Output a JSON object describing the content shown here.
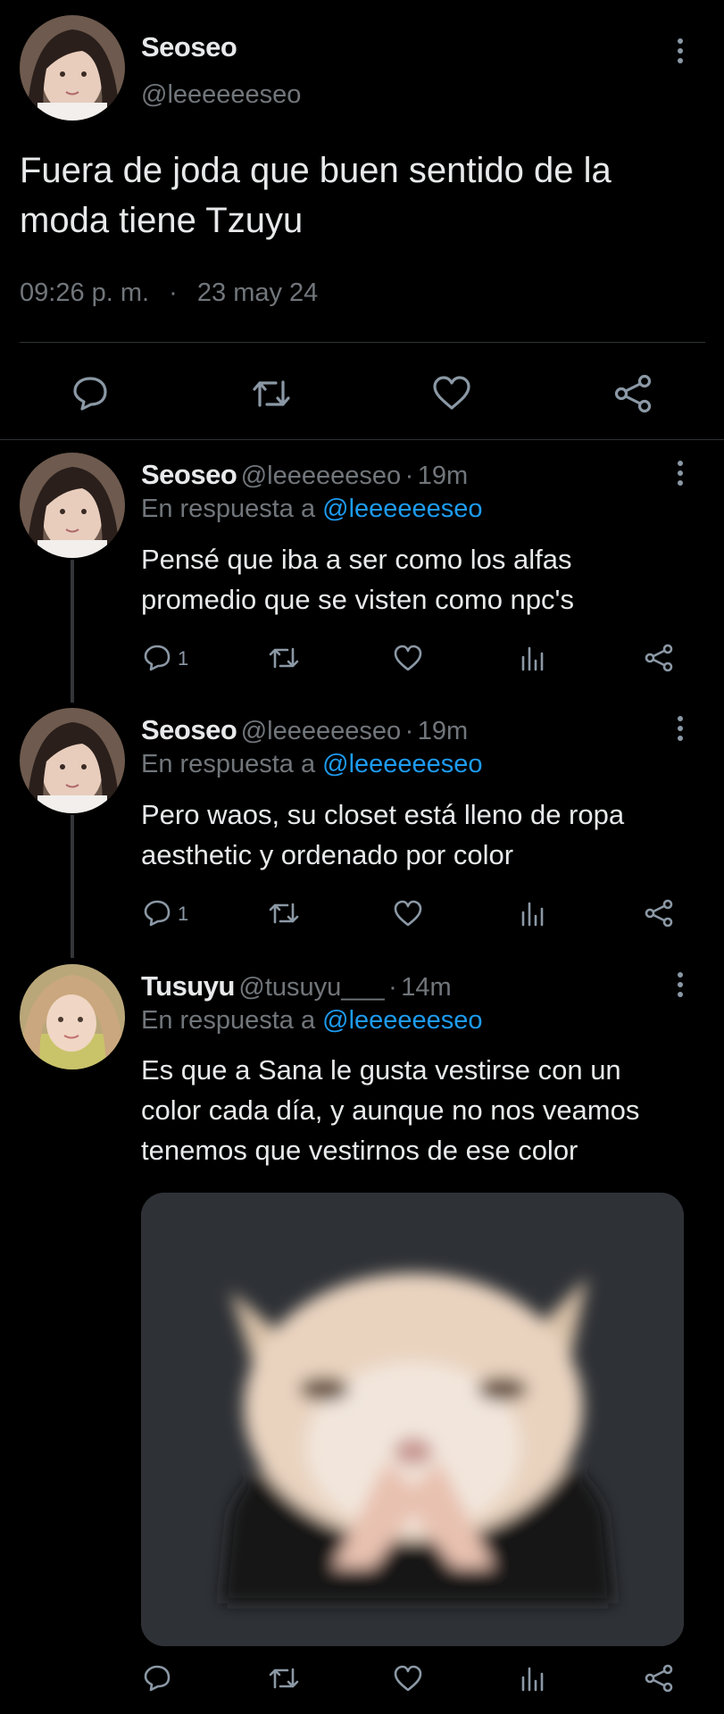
{
  "main_tweet": {
    "author_name": "Seoseo",
    "handle": "@leeeeeeseo",
    "text": "Fuera de joda que buen sentido de la moda tiene Tzuyu",
    "time": "09:26 p. m.",
    "separator": "·",
    "date": "23 may 24"
  },
  "replies": [
    {
      "author_name": "Seoseo",
      "handle": "@leeeeeeseo",
      "dot": "·",
      "age": "19m",
      "reply_prefix": "En respuesta a",
      "reply_handle": "@leeeeeeseo",
      "text": "Pensé que iba a ser como los alfas promedio que se visten como npc's",
      "reply_count": "1"
    },
    {
      "author_name": "Seoseo",
      "handle": "@leeeeeeseo",
      "dot": "·",
      "age": "19m",
      "reply_prefix": "En respuesta a",
      "reply_handle": "@leeeeeeseo",
      "text": "Pero waos, su closet está lleno de ropa aesthetic y ordenado por color",
      "reply_count": "1"
    },
    {
      "author_name": "Tusuyu",
      "handle": "@tusuyu___",
      "dot": "·",
      "age": "14m",
      "reply_prefix": "En respuesta a",
      "reply_handle": "@leeeeeeseo",
      "text": "Es que a Sana le gusta vestirse con un color cada día, y aunque no nos veamos tenemos que vestirnos de ese color",
      "reply_count": ""
    }
  ],
  "icons": [
    "comment-icon",
    "retweet-icon",
    "like-icon",
    "views-icon",
    "share-icon",
    "more-icon"
  ],
  "colors": {
    "background": "#000000",
    "text": "#e7e9ea",
    "muted": "#71767b",
    "link": "#1d9bf0",
    "icon": "#8b98a5",
    "divider": "#2f3336"
  }
}
